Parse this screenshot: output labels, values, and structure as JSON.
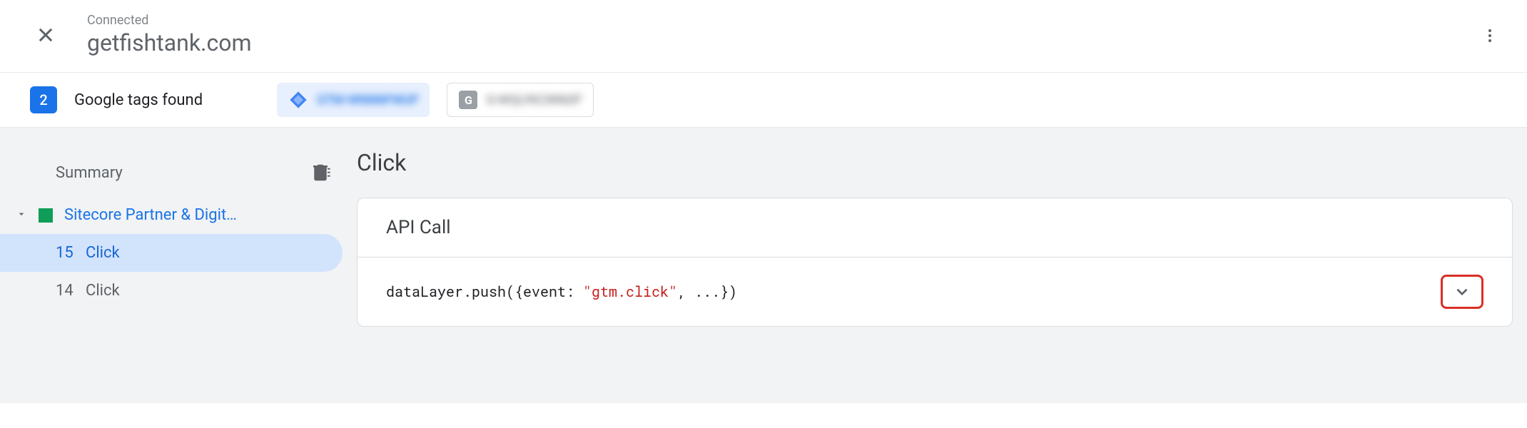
{
  "header": {
    "connected": "Connected",
    "domain": "getfishtank.com"
  },
  "tagsBar": {
    "count": "2",
    "label": "Google tags found",
    "chip1": "GTM-WNNNFWUP",
    "chip2": "G-WQLYKCWNGP",
    "gtagLetter": "G"
  },
  "sidebar": {
    "summary": "Summary",
    "pageTitle": "Sitecore Partner & Digit…",
    "events": [
      {
        "num": "15",
        "name": "Click"
      },
      {
        "num": "14",
        "name": "Click"
      }
    ]
  },
  "content": {
    "title": "Click",
    "apiCall": "API Call",
    "code": {
      "prefix": "dataLayer.push({event: ",
      "string": "\"gtm.click\"",
      "suffix": ", ...})"
    }
  }
}
